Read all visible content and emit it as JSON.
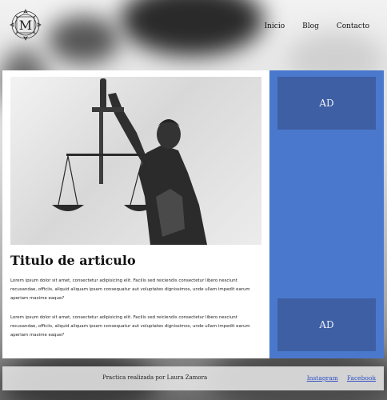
{
  "header": {
    "logo_letter": "M",
    "nav": [
      {
        "label": "Inicio"
      },
      {
        "label": "Blog"
      },
      {
        "label": "Contacto"
      }
    ]
  },
  "article": {
    "title": "Titulo de articulo",
    "paragraphs": [
      "Lorem ipsum dolor sit amet, consectetur adipisicing elit. Facilis sed reiciendis consectetur libero nesciunt recusandae, officiis, aliquid aliquam ipsam consequatur aut voluptates dignissimos, unde ullam impedit earum aperiam maxime eaque?",
      "Lorem ipsum dolor sit amet, consectetur adipisicing elit. Facilis sed reiciendis consectetur libero nesciunt recusandae, officiis, aliquid aliquam ipsam consequatur aut voluptates dignissimos, unde ullam impedit earum aperiam maxime eaque?"
    ]
  },
  "sidebar": {
    "ads": [
      {
        "label": "AD"
      },
      {
        "label": "AD"
      }
    ]
  },
  "footer": {
    "credit": "Practica realizada por Laura Zamora",
    "links": [
      {
        "label": "Instagram"
      },
      {
        "label": "Facebook"
      }
    ]
  },
  "colors": {
    "sidebar": "#4a78cc",
    "ad_box": "#3e5fa4",
    "link": "#2d4fc4"
  }
}
